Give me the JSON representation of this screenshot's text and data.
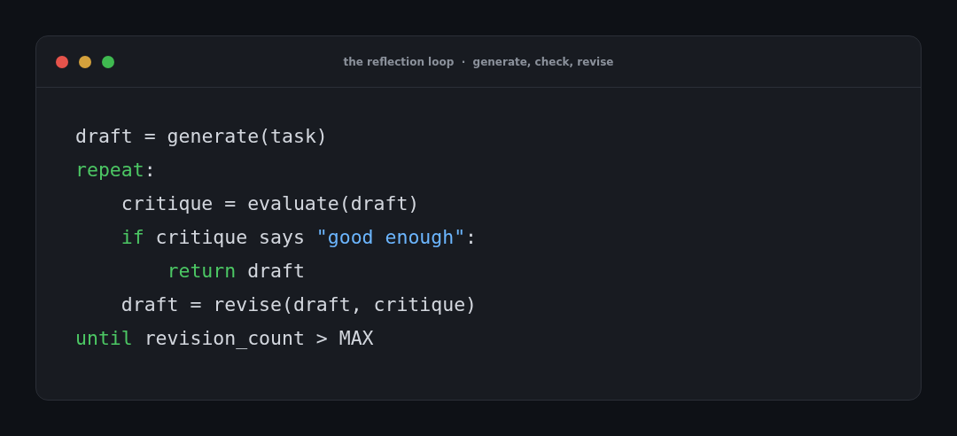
{
  "window": {
    "title": "the reflection loop  ·  generate, check, revise"
  },
  "code_lines": [
    {
      "tokens": [
        {
          "kind": "plain",
          "text": "draft = generate(task)"
        }
      ]
    },
    {
      "tokens": [
        {
          "kind": "keyword",
          "text": "repeat"
        },
        {
          "kind": "plain",
          "text": ":"
        }
      ],
      "children": [
        {
          "tokens": [
            {
              "kind": "plain",
              "text": "critique = evaluate(draft)"
            }
          ]
        },
        {
          "tokens": [
            {
              "kind": "keyword",
              "text": "if"
            },
            {
              "kind": "plain",
              "text": " critique says "
            },
            {
              "kind": "string",
              "text": "\"good enough\""
            },
            {
              "kind": "plain",
              "text": ":"
            }
          ],
          "children": [
            {
              "tokens": [
                {
                  "kind": "keyword",
                  "text": "return"
                },
                {
                  "kind": "plain",
                  "text": " draft"
                }
              ]
            }
          ]
        },
        {
          "tokens": [
            {
              "kind": "plain",
              "text": "draft = revise(draft, critique)"
            }
          ]
        }
      ]
    },
    {
      "tokens": [
        {
          "kind": "keyword",
          "text": "until"
        },
        {
          "kind": "plain",
          "text": " revision_count > MAX"
        }
      ]
    }
  ]
}
